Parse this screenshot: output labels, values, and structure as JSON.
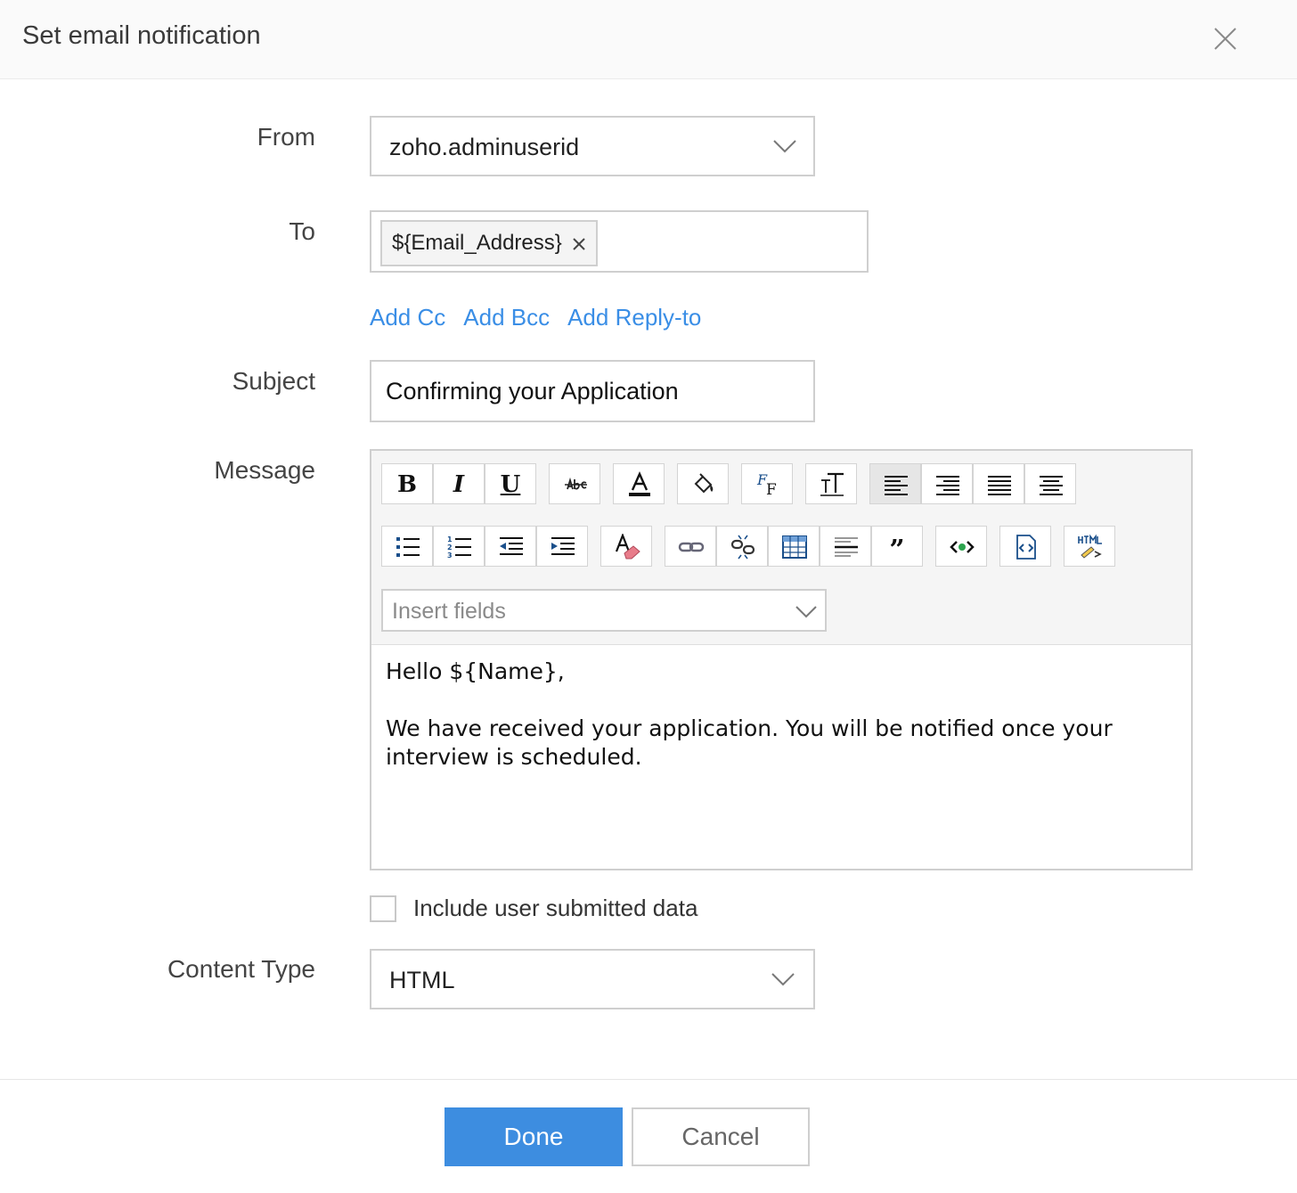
{
  "dialog": {
    "title": "Set email notification"
  },
  "form": {
    "from_label": "From",
    "from_value": "zoho.adminuserid",
    "to_label": "To",
    "to_chip": "${Email_Address}",
    "links": [
      "Add Cc",
      "Add Bcc",
      "Add Reply-to"
    ],
    "subject_label": "Subject",
    "subject_value": "Confirming your Application",
    "message_label": "Message",
    "insert_fields_placeholder": "Insert fields",
    "message_lines": [
      "Hello ${Name},",
      "",
      "We have received your application. You will be notified once your interview is scheduled."
    ],
    "include_label": "Include user submitted data",
    "include_checked": false,
    "content_type_label": "Content Type",
    "content_type_value": "HTML"
  },
  "toolbar": {
    "row1": [
      "bold-icon",
      "italic-icon",
      "underline-icon",
      "strikethrough-icon",
      "font-color-icon",
      "background-color-icon",
      "font-family-icon",
      "font-size-icon",
      "align-left-icon",
      "align-right-icon",
      "justify-icon",
      "align-center-icon"
    ],
    "row2": [
      "bullet-list-icon",
      "numbered-list-icon",
      "outdent-icon",
      "indent-icon",
      "clear-format-icon",
      "insert-link-icon",
      "remove-link-icon",
      "insert-table-icon",
      "horizontal-rule-icon",
      "blockquote-icon",
      "source-code-icon",
      "insert-html-snippet-icon",
      "html-mode-icon"
    ],
    "glyphs": {
      "bold": "B",
      "italic": "I",
      "underline": "U",
      "quote": "”"
    }
  },
  "footer": {
    "done_label": "Done",
    "cancel_label": "Cancel"
  },
  "colors": {
    "primary": "#3d8de0",
    "link": "#3a8ee6",
    "border": "#cfcfcf"
  }
}
